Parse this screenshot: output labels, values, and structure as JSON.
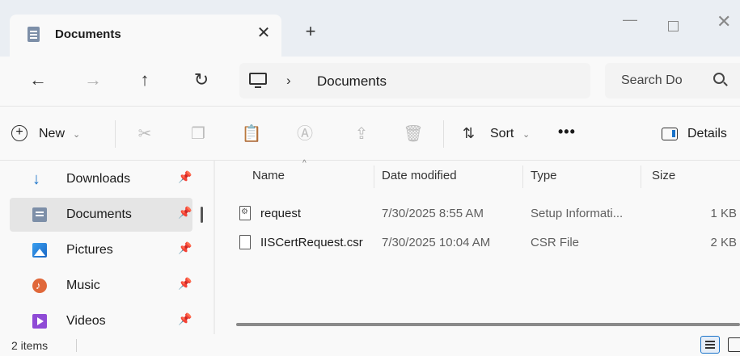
{
  "window": {
    "tab_title": "Documents",
    "tab_close": "✕",
    "new_tab": "+",
    "minimize": "—",
    "close": "✕"
  },
  "address": {
    "back": "←",
    "forward": "→",
    "up": "↑",
    "refresh": "↻",
    "separator": "›",
    "crumb": "Documents",
    "search_placeholder": "Search Do"
  },
  "commands": {
    "new_plus": "+",
    "new_label": "New",
    "chevron": "⌄",
    "cut": "✂",
    "copy": "❐",
    "paste": "📋",
    "rename": "Ⓐ",
    "share": "⇪",
    "delete": "🗑",
    "sort_icon": "⇅",
    "sort_label": "Sort",
    "more": "•••",
    "details_label": "Details"
  },
  "navigation": {
    "pin": "📌",
    "items": [
      {
        "label": "Downloads",
        "icon": "download-icon"
      },
      {
        "label": "Documents",
        "icon": "documents-icon"
      },
      {
        "label": "Pictures",
        "icon": "pictures-icon"
      },
      {
        "label": "Music",
        "icon": "music-icon"
      },
      {
        "label": "Videos",
        "icon": "videos-icon"
      }
    ],
    "selected": "Documents"
  },
  "columns": {
    "name": "Name",
    "date": "Date modified",
    "type": "Type",
    "size": "Size",
    "sort_caret": "^"
  },
  "files": [
    {
      "name": "request",
      "date": "7/30/2025 8:55 AM",
      "type": "Setup Informati...",
      "size": "1 KB",
      "icon": "setup-file-icon"
    },
    {
      "name": "IISCertRequest.csr",
      "date": "7/30/2025 10:04 AM",
      "type": "CSR File",
      "size": "2 KB",
      "icon": "file-icon"
    }
  ],
  "status": {
    "count": "2 items"
  },
  "colors": {
    "accent": "#1a73c9",
    "selection": "#e5e5e5",
    "titlebar": "#eaeef3"
  }
}
